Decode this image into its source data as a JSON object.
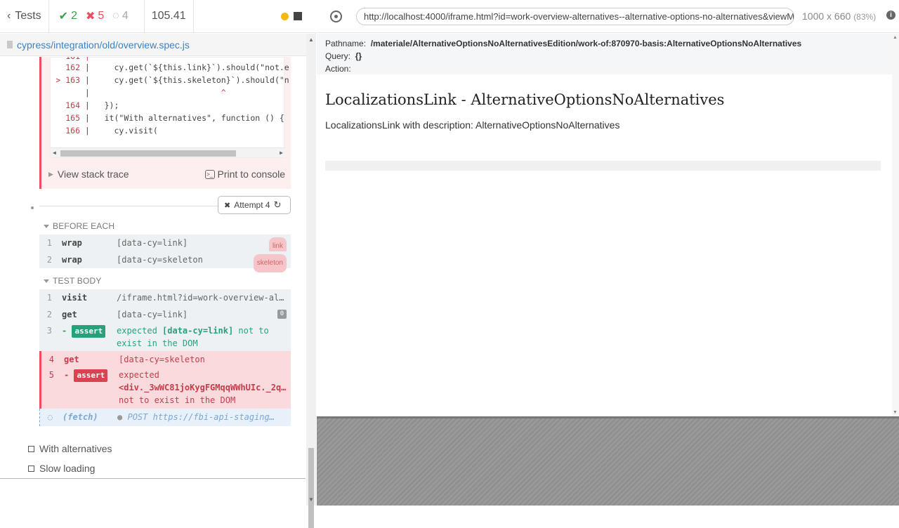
{
  "header": {
    "tests_label": "Tests",
    "passed": "2",
    "failed": "5",
    "pending": "4",
    "duration": "105.41"
  },
  "spec_file": "cypress/integration/old/overview.spec.js",
  "code_frame": {
    "lines": [
      {
        "num": "162",
        "marker": "",
        "code": "    cy.get(`${this.link}`).should(\"not.e"
      },
      {
        "num": "163",
        "marker": ">",
        "code": "    cy.get(`${this.skeleton}`).should(\"n"
      },
      {
        "num": "",
        "marker": "",
        "code": "                          ^"
      },
      {
        "num": "164",
        "marker": "",
        "code": "  });"
      },
      {
        "num": "165",
        "marker": "",
        "code": "  it(\"With alternatives\", function () {"
      },
      {
        "num": "166",
        "marker": "",
        "code": "    cy.visit("
      }
    ],
    "stack_trace_label": "View stack trace",
    "print_label": "Print to console"
  },
  "attempt_label": "Attempt 4",
  "before_each": {
    "title": "BEFORE EACH",
    "commands": [
      {
        "num": "1",
        "name": "wrap",
        "msg": "[data-cy=link]",
        "alias": "link"
      },
      {
        "num": "2",
        "name": "wrap",
        "msg": "[data-cy=skeleton",
        "alias": "skeleton"
      }
    ]
  },
  "test_body": {
    "title": "TEST BODY",
    "commands": [
      {
        "num": "1",
        "name": "visit",
        "msg": "/iframe.html?id=work-overview-al…"
      },
      {
        "num": "2",
        "name": "get",
        "msg": "[data-cy=link]",
        "badge": "0"
      },
      {
        "num": "3",
        "name": "assert",
        "msg_prefix": "expected ",
        "msg_bold": "[data-cy=link]",
        "msg_suffix": " not to",
        "msg_line2": "exist in the DOM"
      },
      {
        "num": "4",
        "name": "get",
        "msg": "[data-cy=skeleton"
      },
      {
        "num": "5",
        "name": "assert",
        "msg_prefix": "expected",
        "msg_bold": "<div._3wWC81joKygFGMqqWWhUIc._2q…",
        "msg_line2": "not to exist in the DOM"
      },
      {
        "name": "(fetch)",
        "msg": "POST https://fbi-api-staging…"
      }
    ]
  },
  "tests": [
    {
      "label": "With alternatives"
    },
    {
      "label": "Slow loading"
    }
  ],
  "aut": {
    "url": "http://localhost:4000/iframe.html?id=work-overview-alternatives--alternative-options-no-alternatives&viewMode=story",
    "viewport": "1000 x 660",
    "scale": "(83%)",
    "pathname_label": "Pathname:",
    "pathname_value": "/materiale/AlternativeOptionsNoAlternativesEdition/work-of:870970-basis:AlternativeOptionsNoAlternatives",
    "query_label": "Query:",
    "query_value": "{}",
    "action_label": "Action:",
    "title": "LocalizationsLink - AlternativeOptionsNoAlternatives",
    "description": "LocalizationsLink with description: AlternativeOptionsNoAlternatives"
  },
  "colors": {
    "pass": "#3a9e4a",
    "fail": "#e94f5f",
    "link": "#3b82c4"
  }
}
